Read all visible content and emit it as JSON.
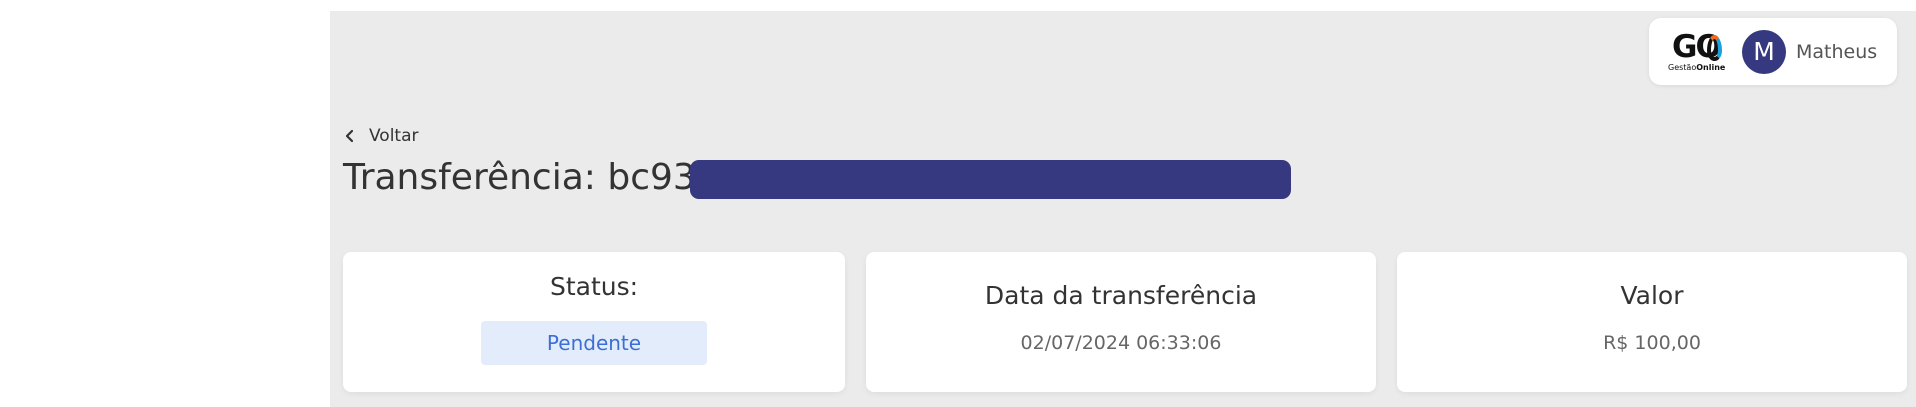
{
  "user": {
    "logo_mark": "GO",
    "logo_sub_1": "Gestão",
    "logo_sub_2": "Online",
    "avatar_initial": "M",
    "name": "Matheus"
  },
  "nav": {
    "back_label": "Voltar"
  },
  "page": {
    "title": "Transferência: bc93"
  },
  "cards": {
    "status_label": "Status:",
    "status_value": "Pendente",
    "date_label": "Data da transferência",
    "date_value": "02/07/2024 06:33:06",
    "amount_label": "Valor",
    "amount_value": "R$ 100,00"
  },
  "colors": {
    "brand": "#363880",
    "status_badge_bg": "#e3ecfb",
    "status_badge_text": "#3b6fd4"
  },
  "icons": {
    "back": "chevron-left-icon"
  }
}
